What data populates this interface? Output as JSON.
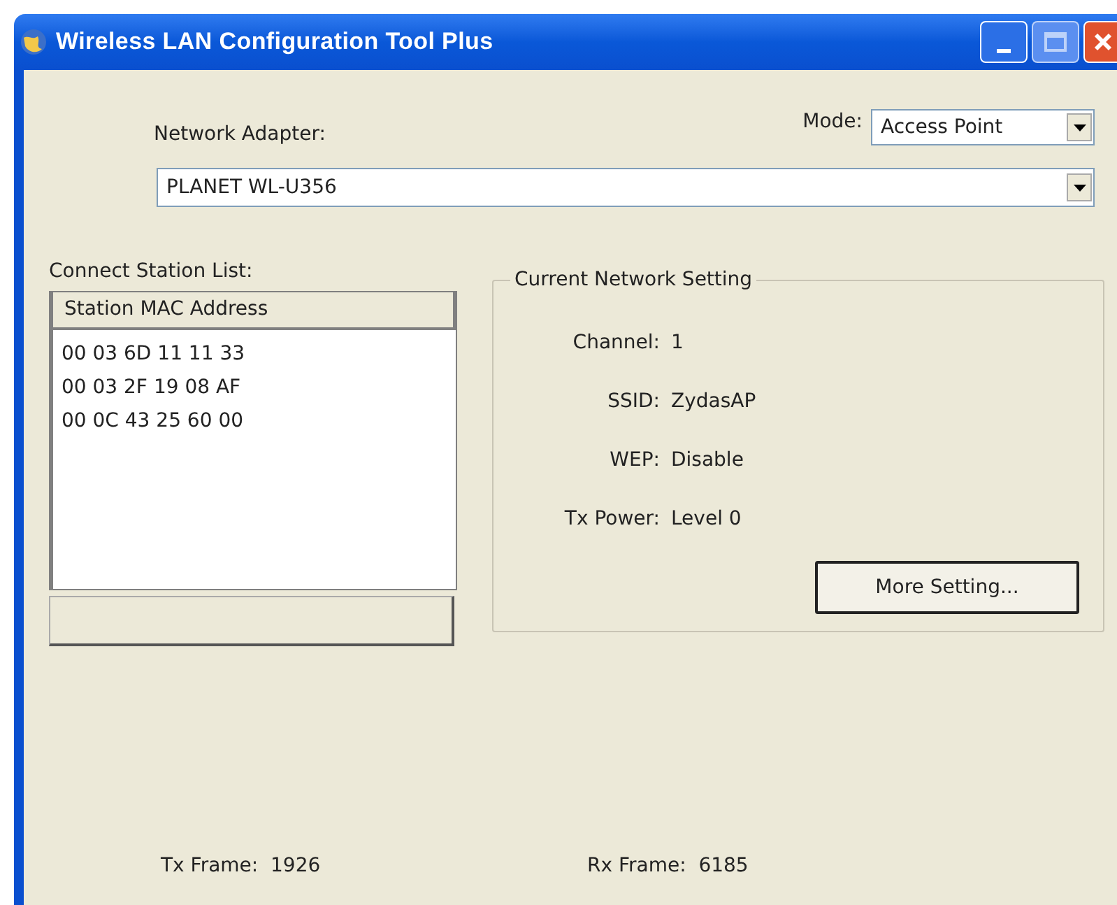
{
  "window": {
    "title": "Wireless LAN Configuration Tool Plus"
  },
  "mode": {
    "label": "Mode:",
    "value": "Access Point"
  },
  "network_adapter": {
    "label": "Network Adapter:",
    "value": "PLANET WL-U356"
  },
  "station_list": {
    "label": "Connect Station List:",
    "column": "Station MAC Address",
    "rows": [
      "00 03 6D 11 11 33",
      "00 03 2F 19 08 AF",
      "00 0C 43 25 60 00"
    ]
  },
  "current_network_setting": {
    "title": "Current Network Setting",
    "fields": [
      {
        "label": "Channel:",
        "value": "1"
      },
      {
        "label": "SSID:",
        "value": "ZydasAP"
      },
      {
        "label": "WEP:",
        "value": "Disable"
      },
      {
        "label": "Tx Power:",
        "value": "Level 0"
      }
    ],
    "button": "More Setting..."
  },
  "status": [
    {
      "label": "Tx Frame:",
      "value": "1926"
    },
    {
      "label": "Rx Frame:",
      "value": "6185"
    }
  ]
}
